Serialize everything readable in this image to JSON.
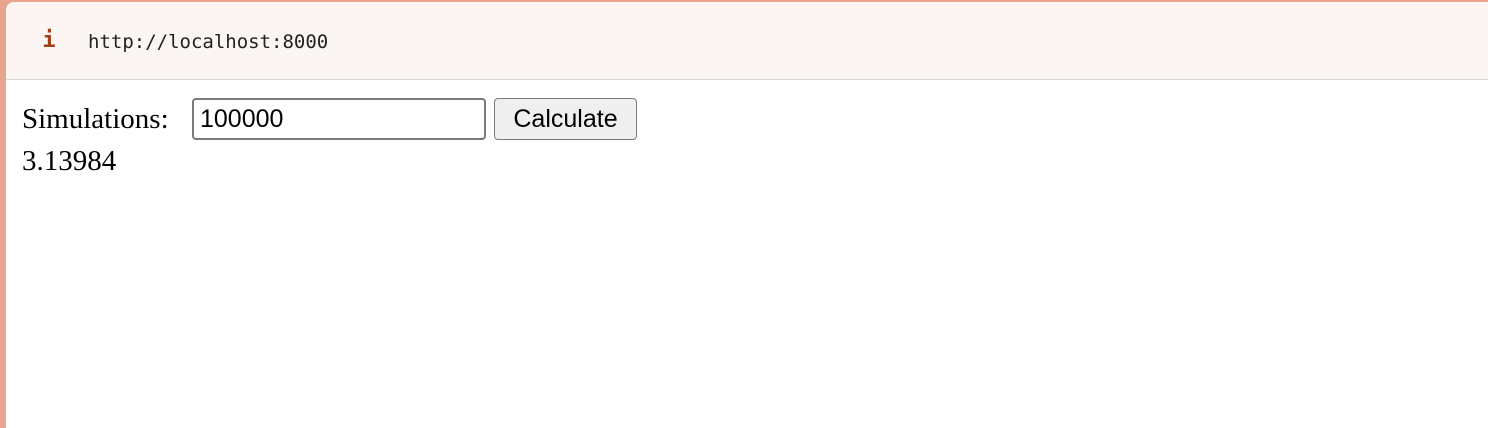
{
  "addressbar": {
    "icon": "info-icon",
    "info_glyph": "i",
    "url": "http://localhost:8000"
  },
  "form": {
    "label": "Simulations:",
    "input_value": "100000",
    "button_label": "Calculate"
  },
  "result": {
    "value": "3.13984"
  },
  "colors": {
    "frame": "#e7a48f",
    "addressbar_bg": "#fbf6f3",
    "info_icon": "#a0401a"
  }
}
